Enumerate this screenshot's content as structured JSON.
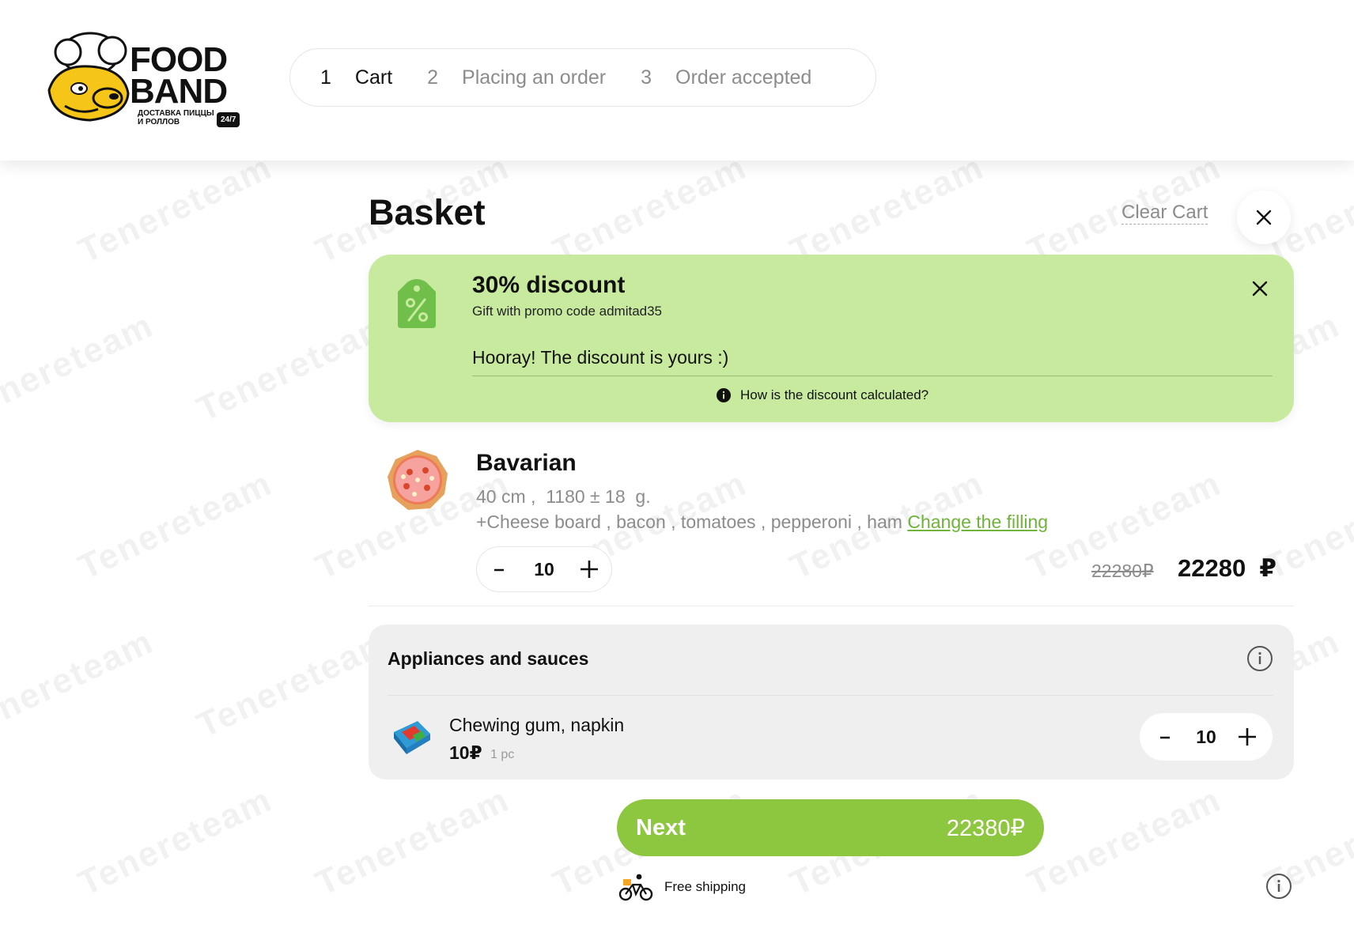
{
  "brand": {
    "line1": "FOOD",
    "line2": "BAND",
    "sub1": "ДОСТАВКА ПИЦЦЫ",
    "sub2": "И РОЛЛОВ",
    "badge": "24/7"
  },
  "steps": [
    {
      "num": "1",
      "label": "Cart"
    },
    {
      "num": "2",
      "label": "Placing an order"
    },
    {
      "num": "3",
      "label": "Order accepted"
    }
  ],
  "basket": {
    "title": "Basket",
    "clear_label": "Clear Cart"
  },
  "discount": {
    "title": "30% discount",
    "subtitle": "Gift with promo code admitad35",
    "message": "Hooray! The discount is yours :)",
    "how_label": "How is the discount calculated?"
  },
  "product": {
    "name": "Bavarian",
    "size_line": "40 cm ,  1180 ± 18  g.",
    "fillings": "+Cheese board , bacon , tomatoes , pepperoni , ham ",
    "change_label": "Change the filling",
    "quantity": "10",
    "old_price": "22280₽",
    "price": "22280  ₽"
  },
  "appliances": {
    "title": "Appliances and sauces",
    "item_name": "Chewing gum, napkin",
    "item_price": "10₽",
    "item_unit": "1 pc",
    "quantity": "10"
  },
  "checkout": {
    "next_label": "Next",
    "total": "22380₽",
    "shipping_label": "Free shipping"
  },
  "watermark": "Tenereteam",
  "colors": {
    "accent": "#8dc63f",
    "discount_bg": "#c8ea9e",
    "link": "#6fb33b"
  }
}
